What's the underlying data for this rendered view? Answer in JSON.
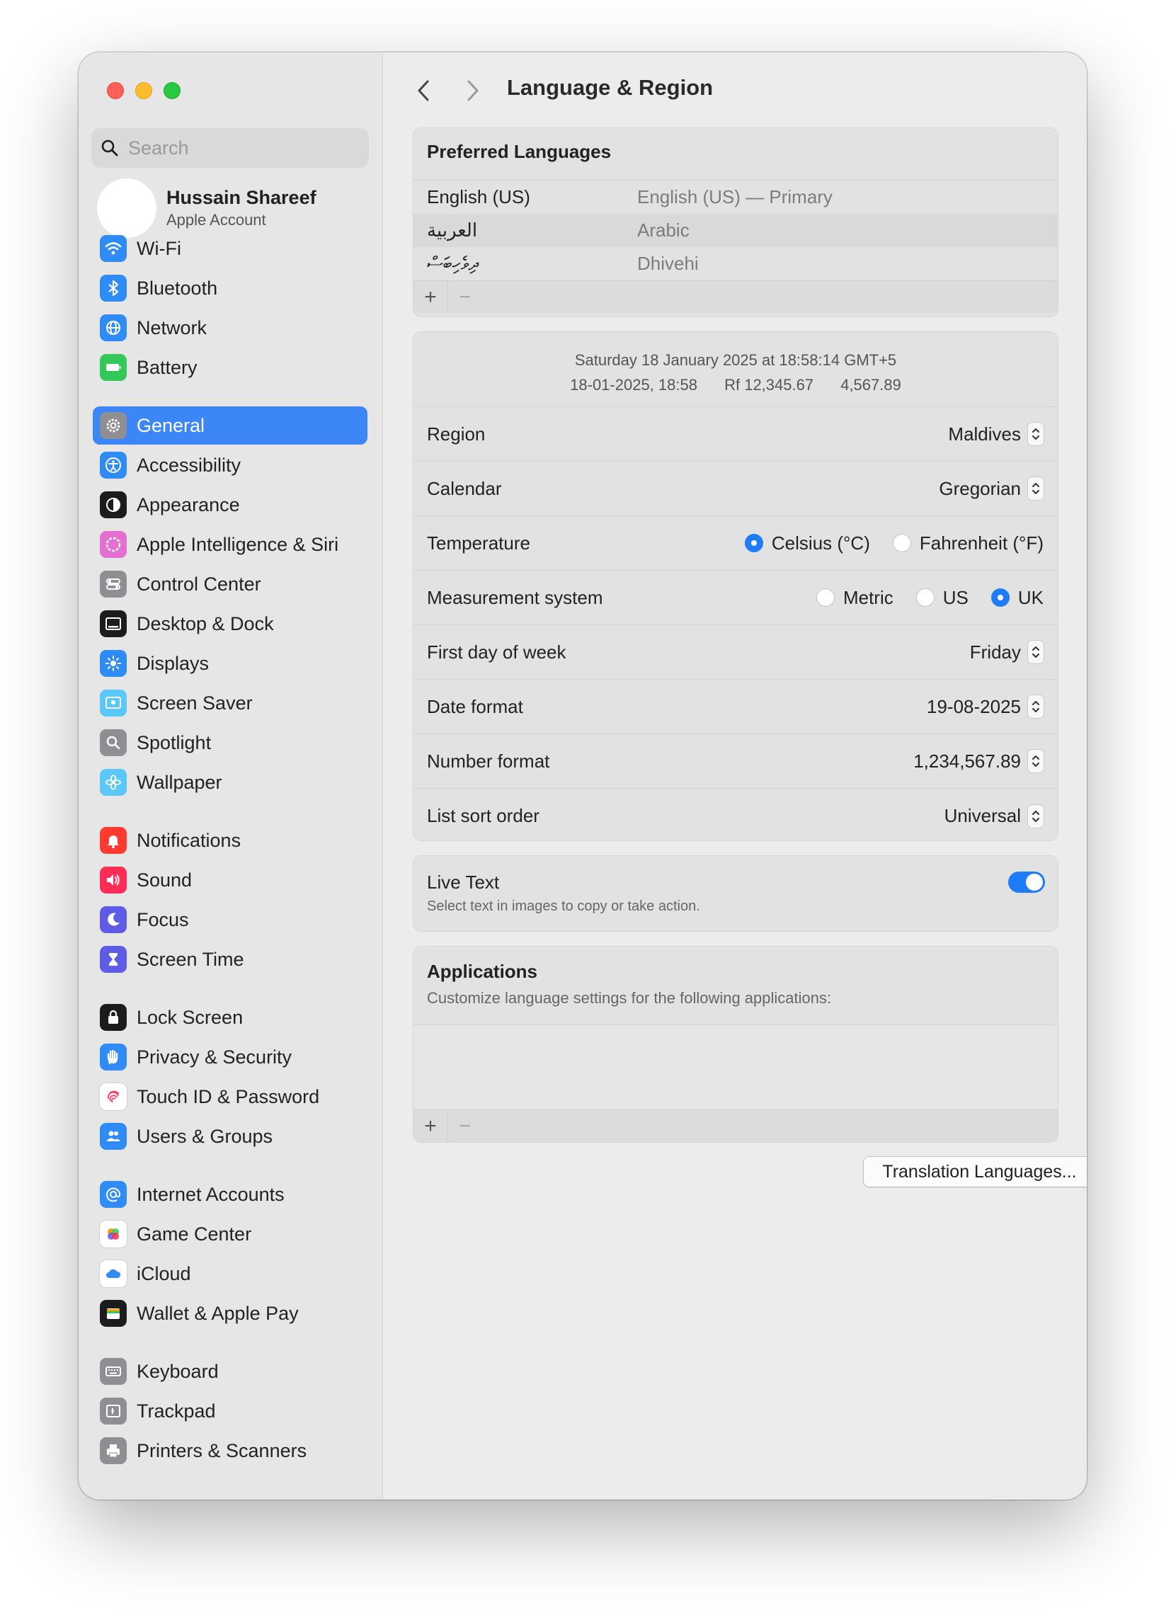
{
  "window": {
    "title": "Language & Region"
  },
  "sidebar": {
    "search_placeholder": "Search",
    "account": {
      "name": "Hussain Shareef",
      "subtitle": "Apple Account"
    },
    "items": [
      {
        "label": "Wi-Fi",
        "icon": "wifi-icon",
        "color": "#2f8cf6"
      },
      {
        "label": "Bluetooth",
        "icon": "bluetooth-icon",
        "color": "#2f8cf6"
      },
      {
        "label": "Network",
        "icon": "globe-icon",
        "color": "#2f8cf6"
      },
      {
        "label": "Battery",
        "icon": "battery-icon",
        "color": "#34c759"
      },
      {
        "label": "General",
        "icon": "gear-icon",
        "color": "#8e8e93",
        "active": true
      },
      {
        "label": "Accessibility",
        "icon": "accessibility-icon",
        "color": "#2f8cf6"
      },
      {
        "label": "Appearance",
        "icon": "appearance-icon",
        "color": "#1c1c1e"
      },
      {
        "label": "Apple Intelligence & Siri",
        "icon": "siri-icon",
        "color": "#e56fd0"
      },
      {
        "label": "Control Center",
        "icon": "control-center-icon",
        "color": "#8e8e93"
      },
      {
        "label": "Desktop & Dock",
        "icon": "dock-icon",
        "color": "#1c1c1e"
      },
      {
        "label": "Displays",
        "icon": "sun-icon",
        "color": "#2f8cf6"
      },
      {
        "label": "Screen Saver",
        "icon": "screen-saver-icon",
        "color": "#5ac8fa"
      },
      {
        "label": "Spotlight",
        "icon": "magnifier-icon",
        "color": "#8e8e93"
      },
      {
        "label": "Wallpaper",
        "icon": "flower-icon",
        "color": "#5ac8fa"
      },
      {
        "label": "Notifications",
        "icon": "bell-icon",
        "color": "#ff3b30"
      },
      {
        "label": "Sound",
        "icon": "speaker-icon",
        "color": "#ff2d55"
      },
      {
        "label": "Focus",
        "icon": "moon-icon",
        "color": "#5e5ce6"
      },
      {
        "label": "Screen Time",
        "icon": "hourglass-icon",
        "color": "#5e5ce6"
      },
      {
        "label": "Lock Screen",
        "icon": "lock-icon",
        "color": "#1c1c1e"
      },
      {
        "label": "Privacy & Security",
        "icon": "hand-icon",
        "color": "#2f8cf6"
      },
      {
        "label": "Touch ID & Password",
        "icon": "fingerprint-icon",
        "color": "#ffffff"
      },
      {
        "label": "Users & Groups",
        "icon": "users-icon",
        "color": "#2f8cf6"
      },
      {
        "label": "Internet Accounts",
        "icon": "at-icon",
        "color": "#2f8cf6"
      },
      {
        "label": "Game Center",
        "icon": "game-center-icon",
        "color": "#ffffff"
      },
      {
        "label": "iCloud",
        "icon": "cloud-icon",
        "color": "#ffffff"
      },
      {
        "label": "Wallet & Apple Pay",
        "icon": "wallet-icon",
        "color": "#1c1c1e"
      },
      {
        "label": "Keyboard",
        "icon": "keyboard-icon",
        "color": "#8e8e93"
      },
      {
        "label": "Trackpad",
        "icon": "trackpad-icon",
        "color": "#8e8e93"
      },
      {
        "label": "Printers & Scanners",
        "icon": "printer-icon",
        "color": "#8e8e93"
      }
    ]
  },
  "preferred_languages": {
    "heading": "Preferred Languages",
    "rows": [
      {
        "name": "English (US)",
        "description": "English (US) — Primary"
      },
      {
        "name": "العربية",
        "description": "Arabic"
      },
      {
        "name": "ދިވެހިބަސް",
        "description": "Dhivehi"
      }
    ],
    "add": "+",
    "remove": "−"
  },
  "format_preview": {
    "line1": "Saturday 18 January 2025 at 18:58:14 GMT+5",
    "date_time": "18-01-2025, 18:58",
    "currency": "Rf 12,345.67",
    "number": "4,567.89"
  },
  "settings": {
    "region": {
      "label": "Region",
      "value": "Maldives"
    },
    "calendar": {
      "label": "Calendar",
      "value": "Gregorian"
    },
    "temperature": {
      "label": "Temperature",
      "options": [
        "Celsius (°C)",
        "Fahrenheit (°F)"
      ],
      "selected": "Celsius (°C)"
    },
    "measurement": {
      "label": "Measurement system",
      "options": [
        "Metric",
        "US",
        "UK"
      ],
      "selected": "UK"
    },
    "first_day": {
      "label": "First day of week",
      "value": "Friday"
    },
    "date_format": {
      "label": "Date format",
      "value": "19-08-2025"
    },
    "number_format": {
      "label": "Number format",
      "value": "1,234,567.89"
    },
    "sort_order": {
      "label": "List sort order",
      "value": "Universal"
    }
  },
  "live_text": {
    "title": "Live Text",
    "subtitle": "Select text in images to copy or take action.",
    "enabled": true
  },
  "applications": {
    "title": "Applications",
    "subtitle": "Customize language settings for the following applications:",
    "add": "+",
    "remove": "−"
  },
  "buttons": {
    "translation": "Translation Languages...",
    "help": "?"
  }
}
